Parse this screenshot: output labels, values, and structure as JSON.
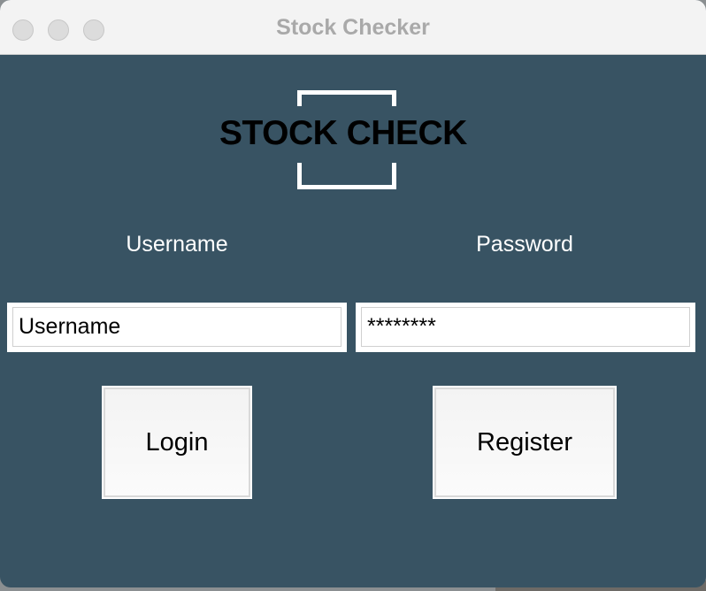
{
  "window": {
    "title": "Stock Checker"
  },
  "logo": {
    "text": "STOCK CHECK"
  },
  "form": {
    "username_label": "Username",
    "password_label": "Password",
    "username_value": "Username",
    "password_value": "********"
  },
  "buttons": {
    "login_label": "Login",
    "register_label": "Register"
  },
  "colors": {
    "background": "#385363",
    "titlebar": "#f3f3f3",
    "title_text": "#a9a9a9"
  }
}
